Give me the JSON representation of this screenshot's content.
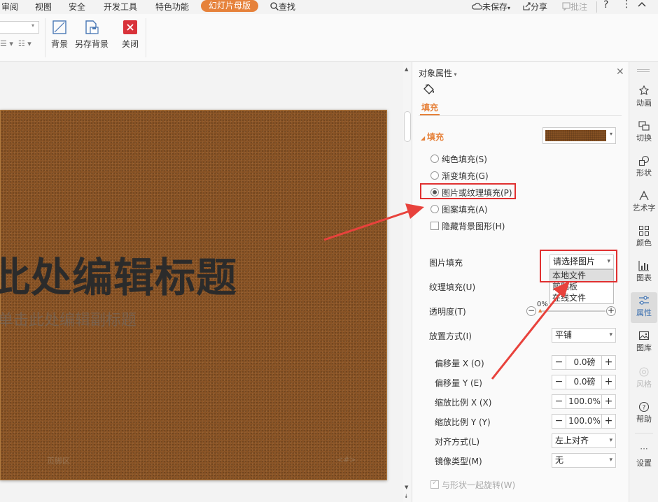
{
  "menubar": {
    "items": [
      "审阅",
      "视图",
      "安全",
      "开发工具",
      "特色功能"
    ],
    "active_tab": "幻灯片母版",
    "search": "查找",
    "unsaved": "未保存",
    "share": "分享",
    "comment": "批注",
    "help": "?"
  },
  "ribbon": {
    "background": "背景",
    "save_background": "另存背景",
    "close": "关闭"
  },
  "slide": {
    "title": "此处编辑标题",
    "subtitle": "单击此处编辑副标题",
    "footer": "页脚区",
    "number": "<#>"
  },
  "panel": {
    "header": "对象属性",
    "tab_fill": "填充",
    "section_fill": "填充",
    "opt_solid": "纯色填充(S)",
    "opt_gradient": "渐变填充(G)",
    "opt_picture": "图片或纹理填充(P)",
    "opt_pattern": "图案填充(A)",
    "opt_hide_bg": "隐藏背景图形(H)",
    "picture_fill_label": "图片填充",
    "picture_fill_value": "请选择图片",
    "picture_fill_options": [
      "本地文件",
      "剪贴板",
      "在线文件"
    ],
    "texture_fill_label": "纹理填充(U)",
    "transparency_label": "透明度(T)",
    "transparency_value": "0%",
    "placement_label": "放置方式(I)",
    "placement_value": "平铺",
    "offset_x_label": "偏移量 X (O)",
    "offset_x_value": "0.0磅",
    "offset_y_label": "偏移量 Y (E)",
    "offset_y_value": "0.0磅",
    "scale_x_label": "缩放比例 X (X)",
    "scale_x_value": "100.0%",
    "scale_y_label": "缩放比例 Y (Y)",
    "scale_y_value": "100.0%",
    "align_label": "对齐方式(L)",
    "align_value": "左上对齐",
    "mirror_label": "镜像类型(M)",
    "mirror_value": "无",
    "rotate_with_shape": "与形状一起旋转(W)"
  },
  "sidebar": {
    "animation": "动画",
    "transition": "切换",
    "shape": "形状",
    "art_text": "艺术字",
    "color": "颜色",
    "chart": "图表",
    "properties": "属性",
    "gallery": "图库",
    "style": "风格",
    "help": "帮助",
    "settings": "设置"
  },
  "colors": {
    "accent": "#e6823b",
    "highlight_red": "#e03030",
    "leather": "#8b5425"
  }
}
